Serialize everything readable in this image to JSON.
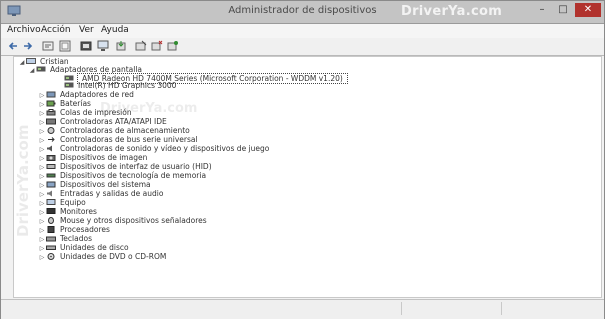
{
  "window": {
    "title": "Administrador de dispositivos",
    "watermark": "DriverYa.com",
    "buttons": {
      "minimize": "–",
      "maximize": "□",
      "close": "✕"
    }
  },
  "menu": [
    "Archivo",
    "Acción",
    "Ver",
    "Ayuda"
  ],
  "toolbar_icons": [
    "back-arrow-icon",
    "forward-arrow-icon",
    "properties-icon",
    "help-icon",
    "scan-icon",
    "monitor-icon",
    "update-driver-icon",
    "disable-device-icon",
    "uninstall-icon"
  ],
  "content_watermarks": {
    "middle": "DriverYa.com",
    "side": "DriverYa.com"
  },
  "tree": {
    "root": "Cristian",
    "categories": [
      {
        "label": "Adaptadores de pantalla",
        "expanded": true,
        "children": [
          "AMD Radeon HD 7400M Series (Microsoft Corporation - WDDM v1.20)",
          "Intel(R) HD Graphics 3000"
        ]
      },
      {
        "label": "Adaptadores de red"
      },
      {
        "label": "Baterías"
      },
      {
        "label": "Colas de impresión"
      },
      {
        "label": "Controladoras ATA/ATAPI IDE"
      },
      {
        "label": "Controladoras de almacenamiento"
      },
      {
        "label": "Controladoras de bus serie universal"
      },
      {
        "label": "Controladoras de sonido y vídeo y dispositivos de juego"
      },
      {
        "label": "Dispositivos de imagen"
      },
      {
        "label": "Dispositivos de interfaz de usuario (HID)"
      },
      {
        "label": "Dispositivos de tecnología de memoria"
      },
      {
        "label": "Dispositivos del sistema"
      },
      {
        "label": "Entradas y salidas de audio"
      },
      {
        "label": "Equipo"
      },
      {
        "label": "Monitores"
      },
      {
        "label": "Mouse y otros dispositivos señaladores"
      },
      {
        "label": "Procesadores"
      },
      {
        "label": "Teclados"
      },
      {
        "label": "Unidades de disco"
      },
      {
        "label": "Unidades de DVD o CD-ROM"
      }
    ]
  }
}
